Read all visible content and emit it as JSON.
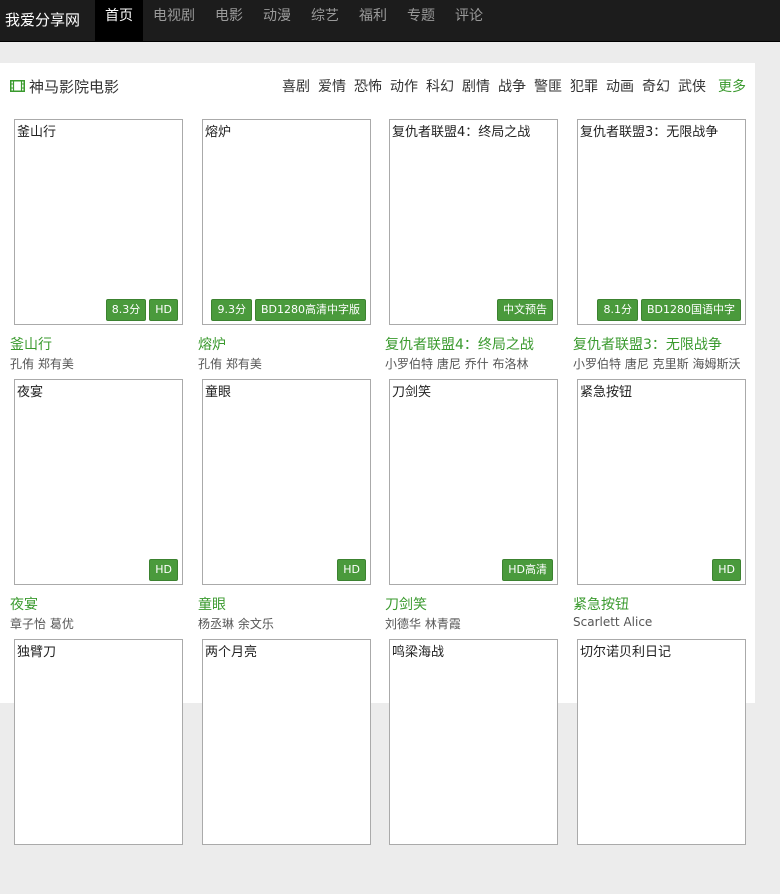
{
  "site": {
    "logo": "我爱分享网"
  },
  "nav": [
    "首页",
    "电视剧",
    "电影",
    "动漫",
    "综艺",
    "福利",
    "专题",
    "评论"
  ],
  "section": {
    "title": "神马影院电影",
    "categories": [
      "喜剧",
      "爱情",
      "恐怖",
      "动作",
      "科幻",
      "剧情",
      "战争",
      "警匪",
      "犯罪",
      "动画",
      "奇幻",
      "武侠"
    ],
    "more": "更多"
  },
  "movies": [
    {
      "title": "釜山行",
      "cast": "孔侑 郑有美",
      "badges": [
        "8.3分",
        "HD"
      ]
    },
    {
      "title": "熔炉",
      "cast": "孔侑 郑有美",
      "badges": [
        "9.3分",
        "BD1280高清中字版"
      ]
    },
    {
      "title": "复仇者联盟4：终局之战",
      "cast": "小罗伯特 唐尼 乔什 布洛林",
      "badges": [
        "中文预告"
      ]
    },
    {
      "title": "复仇者联盟3：无限战争",
      "cast": "小罗伯特 唐尼 克里斯 海姆斯沃",
      "badges": [
        "8.1分",
        "BD1280国语中字"
      ]
    },
    {
      "title": "夜宴",
      "cast": "章子怡 葛优",
      "badges": [
        "HD"
      ]
    },
    {
      "title": "童眼",
      "cast": "杨丞琳 余文乐",
      "badges": [
        "HD"
      ]
    },
    {
      "title": "刀剑笑",
      "cast": "刘德华 林青霞",
      "badges": [
        "HD高清"
      ]
    },
    {
      "title": "紧急按钮",
      "cast": "Scarlett Alice",
      "badges": [
        "HD"
      ]
    },
    {
      "title": "独臂刀",
      "cast": "",
      "badges": []
    },
    {
      "title": "两个月亮",
      "cast": "",
      "badges": []
    },
    {
      "title": "鸣梁海战",
      "cast": "",
      "badges": []
    },
    {
      "title": "切尔诺贝利日记",
      "cast": "",
      "badges": []
    }
  ],
  "colors": {
    "topbar": "#1c1c1c",
    "accent": "#3a9a2e",
    "badge": "#4a9a3c"
  }
}
